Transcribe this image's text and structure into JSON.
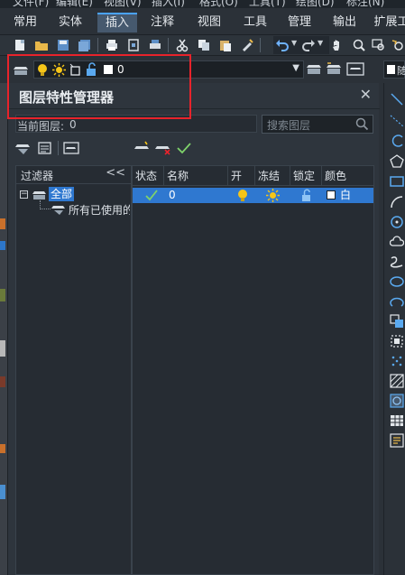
{
  "menu": [
    "文件(F)",
    "编辑(E)",
    "视图(V)",
    "插入(I)",
    "格式(O)",
    "工具(T)",
    "绘图(D)",
    "标注(N)"
  ],
  "ribbon_tabs": [
    {
      "label": "常用",
      "active": false
    },
    {
      "label": "实体",
      "active": false
    },
    {
      "label": "插入",
      "active": true
    },
    {
      "label": "注释",
      "active": false
    },
    {
      "label": "视图",
      "active": false
    },
    {
      "label": "工具",
      "active": false
    },
    {
      "label": "管理",
      "active": false
    },
    {
      "label": "输出",
      "active": false
    },
    {
      "label": "扩展工",
      "active": false
    }
  ],
  "layer_toolbar": {
    "current_layer": "0",
    "right_combo_label": "随"
  },
  "panel": {
    "title": "图层特性管理器",
    "close": "✕",
    "current_layer_label": "当前图层:",
    "current_layer_value": "0",
    "search_placeholder": "搜索图层"
  },
  "filter_tree": {
    "header": "过滤器",
    "collapse": "<<",
    "root": "全部",
    "child": "所有已使用的图层"
  },
  "layer_table": {
    "columns": [
      "状态",
      "名称",
      "开",
      "冻结",
      "锁定",
      "颜色"
    ],
    "rows": [
      {
        "status": "current",
        "name": "0",
        "on": true,
        "frozen": false,
        "locked": false,
        "color_name": "白",
        "color_hex": "#ffffff"
      }
    ]
  },
  "colors": {
    "accent": "#2f78d0",
    "highlight": "#e8232b",
    "bulb": "#f5c518",
    "check": "#7fd36b"
  }
}
